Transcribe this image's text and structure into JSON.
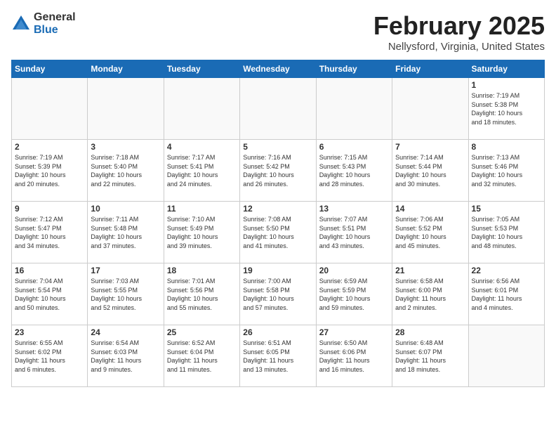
{
  "logo": {
    "general": "General",
    "blue": "Blue"
  },
  "title": "February 2025",
  "subtitle": "Nellysford, Virginia, United States",
  "days_of_week": [
    "Sunday",
    "Monday",
    "Tuesday",
    "Wednesday",
    "Thursday",
    "Friday",
    "Saturday"
  ],
  "weeks": [
    [
      {
        "day": "",
        "info": ""
      },
      {
        "day": "",
        "info": ""
      },
      {
        "day": "",
        "info": ""
      },
      {
        "day": "",
        "info": ""
      },
      {
        "day": "",
        "info": ""
      },
      {
        "day": "",
        "info": ""
      },
      {
        "day": "1",
        "info": "Sunrise: 7:19 AM\nSunset: 5:38 PM\nDaylight: 10 hours\nand 18 minutes."
      }
    ],
    [
      {
        "day": "2",
        "info": "Sunrise: 7:19 AM\nSunset: 5:39 PM\nDaylight: 10 hours\nand 20 minutes."
      },
      {
        "day": "3",
        "info": "Sunrise: 7:18 AM\nSunset: 5:40 PM\nDaylight: 10 hours\nand 22 minutes."
      },
      {
        "day": "4",
        "info": "Sunrise: 7:17 AM\nSunset: 5:41 PM\nDaylight: 10 hours\nand 24 minutes."
      },
      {
        "day": "5",
        "info": "Sunrise: 7:16 AM\nSunset: 5:42 PM\nDaylight: 10 hours\nand 26 minutes."
      },
      {
        "day": "6",
        "info": "Sunrise: 7:15 AM\nSunset: 5:43 PM\nDaylight: 10 hours\nand 28 minutes."
      },
      {
        "day": "7",
        "info": "Sunrise: 7:14 AM\nSunset: 5:44 PM\nDaylight: 10 hours\nand 30 minutes."
      },
      {
        "day": "8",
        "info": "Sunrise: 7:13 AM\nSunset: 5:46 PM\nDaylight: 10 hours\nand 32 minutes."
      }
    ],
    [
      {
        "day": "9",
        "info": "Sunrise: 7:12 AM\nSunset: 5:47 PM\nDaylight: 10 hours\nand 34 minutes."
      },
      {
        "day": "10",
        "info": "Sunrise: 7:11 AM\nSunset: 5:48 PM\nDaylight: 10 hours\nand 37 minutes."
      },
      {
        "day": "11",
        "info": "Sunrise: 7:10 AM\nSunset: 5:49 PM\nDaylight: 10 hours\nand 39 minutes."
      },
      {
        "day": "12",
        "info": "Sunrise: 7:08 AM\nSunset: 5:50 PM\nDaylight: 10 hours\nand 41 minutes."
      },
      {
        "day": "13",
        "info": "Sunrise: 7:07 AM\nSunset: 5:51 PM\nDaylight: 10 hours\nand 43 minutes."
      },
      {
        "day": "14",
        "info": "Sunrise: 7:06 AM\nSunset: 5:52 PM\nDaylight: 10 hours\nand 45 minutes."
      },
      {
        "day": "15",
        "info": "Sunrise: 7:05 AM\nSunset: 5:53 PM\nDaylight: 10 hours\nand 48 minutes."
      }
    ],
    [
      {
        "day": "16",
        "info": "Sunrise: 7:04 AM\nSunset: 5:54 PM\nDaylight: 10 hours\nand 50 minutes."
      },
      {
        "day": "17",
        "info": "Sunrise: 7:03 AM\nSunset: 5:55 PM\nDaylight: 10 hours\nand 52 minutes."
      },
      {
        "day": "18",
        "info": "Sunrise: 7:01 AM\nSunset: 5:56 PM\nDaylight: 10 hours\nand 55 minutes."
      },
      {
        "day": "19",
        "info": "Sunrise: 7:00 AM\nSunset: 5:58 PM\nDaylight: 10 hours\nand 57 minutes."
      },
      {
        "day": "20",
        "info": "Sunrise: 6:59 AM\nSunset: 5:59 PM\nDaylight: 10 hours\nand 59 minutes."
      },
      {
        "day": "21",
        "info": "Sunrise: 6:58 AM\nSunset: 6:00 PM\nDaylight: 11 hours\nand 2 minutes."
      },
      {
        "day": "22",
        "info": "Sunrise: 6:56 AM\nSunset: 6:01 PM\nDaylight: 11 hours\nand 4 minutes."
      }
    ],
    [
      {
        "day": "23",
        "info": "Sunrise: 6:55 AM\nSunset: 6:02 PM\nDaylight: 11 hours\nand 6 minutes."
      },
      {
        "day": "24",
        "info": "Sunrise: 6:54 AM\nSunset: 6:03 PM\nDaylight: 11 hours\nand 9 minutes."
      },
      {
        "day": "25",
        "info": "Sunrise: 6:52 AM\nSunset: 6:04 PM\nDaylight: 11 hours\nand 11 minutes."
      },
      {
        "day": "26",
        "info": "Sunrise: 6:51 AM\nSunset: 6:05 PM\nDaylight: 11 hours\nand 13 minutes."
      },
      {
        "day": "27",
        "info": "Sunrise: 6:50 AM\nSunset: 6:06 PM\nDaylight: 11 hours\nand 16 minutes."
      },
      {
        "day": "28",
        "info": "Sunrise: 6:48 AM\nSunset: 6:07 PM\nDaylight: 11 hours\nand 18 minutes."
      },
      {
        "day": "",
        "info": ""
      }
    ]
  ]
}
